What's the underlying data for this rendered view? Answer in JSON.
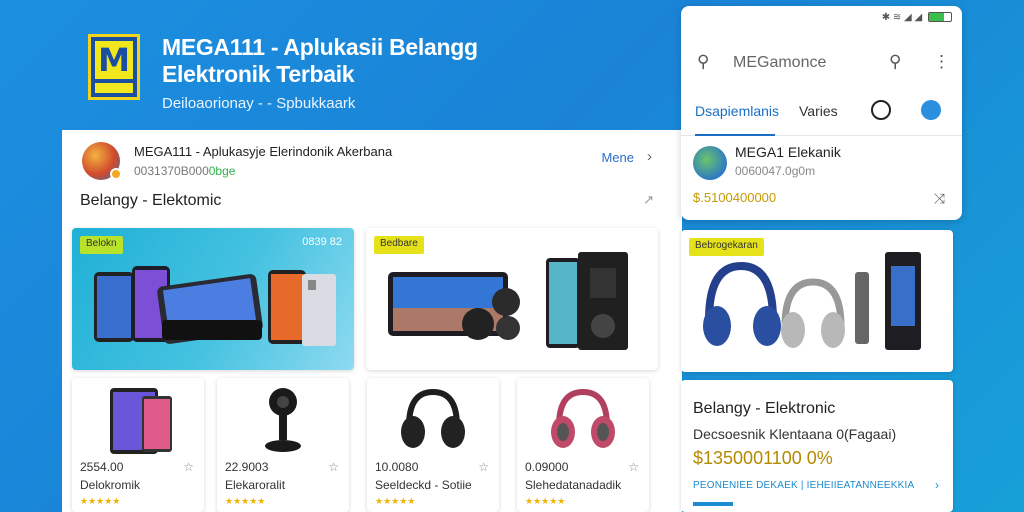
{
  "hero": {
    "logo_letter": "M",
    "title": "MEGA111 - Aplukasii Belangg Elektronik Terbaik",
    "subtitle": "Deiloaorionay - - Spbukkaark"
  },
  "app": {
    "name": "MEGA111 - Aplukasyje Elerindonik Akerbana",
    "meta": "0031370B000",
    "meta_badge": "0bge",
    "more_label": "Mene",
    "more_icon": "chevron-right-icon"
  },
  "section": {
    "title": "Belangy - Elektomic"
  },
  "banners": {
    "a": {
      "tag": "Belokn",
      "price": "0839 82"
    },
    "b": {
      "tag": "Bedbare"
    }
  },
  "products": [
    {
      "price": "2554.00",
      "name": "Delokromik",
      "stars": "★★★★★"
    },
    {
      "price": "22.9003",
      "name": "Elekaroralit",
      "stars": "★★★★★"
    },
    {
      "price": "10.0080",
      "name": "Seeldeckd - Sotiie",
      "stars": "★★★★★"
    },
    {
      "price": "0.09000",
      "name": "Slehedatanadadik",
      "stars": "★★★★★"
    }
  ],
  "phone": {
    "search_placeholder": "MEGamonce",
    "tabs": [
      "Dsapiemlanis",
      "Varies"
    ],
    "item": {
      "name": "MEGA1 Elekanik",
      "meta": "0060047.0g0m",
      "price": "$.5100400000"
    }
  },
  "right_banner": {
    "tag": "Bebrogekaran"
  },
  "right_info": {
    "title": "Belangy - Elektronic",
    "desc": "Decsoesnik Klentaana 0(Fagaai)",
    "price": "$1350001100 0%",
    "link": "PEONENIEE DEKAEK | IEHEIIEATANNEEKKIA"
  },
  "colors": {
    "background": "#1a83d6",
    "accent": "#1a6fc4",
    "price": "#b38a00",
    "tag_yellow": "#e6e21a"
  }
}
